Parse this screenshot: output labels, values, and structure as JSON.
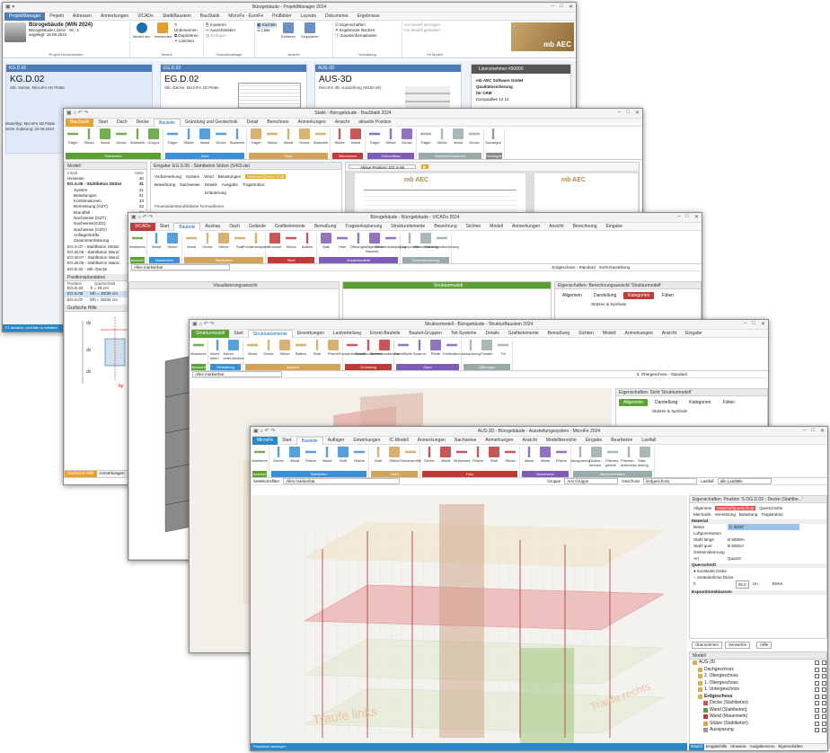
{
  "pm": {
    "title": "Bürogebäude - ProjektManager 2024",
    "tabs": [
      "ProjektManager",
      "Projekt",
      "Adressen",
      "Anmerkungen",
      "ViCADo",
      "StatikBaustein",
      "BauStatik",
      "MicroFe - EuroFe",
      "Prüfbilder",
      "Layouts",
      "Dokumente",
      "Ergebnisse"
    ],
    "project_name": "Bürogebäude (WIN 2024)",
    "project_line2": "Bürogebäude Lizenz - Nr.: 1",
    "project_line3": "angelegt: 18.08.2024",
    "project_group_label": "Projekt Informationen",
    "ribbon": {
      "new_model": "Modell neu",
      "use": "Verwenden",
      "actions": [
        "Unbenennen",
        "Duplizieren",
        "Löschen"
      ],
      "actions2": [
        "Kopieren",
        "Ausschneiden",
        "Einfügen"
      ],
      "view": [
        "Kacheln",
        "Liste"
      ],
      "sort": "Sortieren",
      "group": "Gruppieren",
      "props": [
        "Eigenschaften",
        "Ergebnisse löschen",
        "Zusatzinformationen"
      ],
      "modules": [
        "Ins Modell anzeigen",
        "Ins Modell gestalten"
      ],
      "group_labels": [
        "Projekt Informationen",
        "Modell",
        "Zwischenablage",
        "Ansicht",
        "Verwaltung",
        "Im Modell"
      ]
    },
    "cards": [
      {
        "head": "KG.D.02",
        "title": "KG.D.02",
        "sub": "Stb.-Decke, MicroFe 2D Platte"
      },
      {
        "head": "EG.D.02",
        "title": "EG.D.02",
        "sub": "Stb.-Decke, MicroFe 2D Platte"
      },
      {
        "head": "AUS-3D",
        "title": "AUS-3D",
        "sub": "MicroFe 3D Aussteifung (M150.de)"
      }
    ],
    "license": {
      "head": "Lizenznehmer #50000",
      "l1": "mb AEC Software GmbH",
      "l2": "Qualitätssicherung",
      "l3": "für CRM",
      "l4": "Europaallee 14 14"
    },
    "left_meta": [
      "Modelltyp: MicroFe 2D Platte",
      "letzte Änderung: 20.08.2024"
    ],
    "status": "F1 drücken, um Hilfe zu erhalten"
  },
  "bs": {
    "title": "Statik - Bürogebäude - BauStatik 2024",
    "tabs": [
      "BauStatik",
      "Start",
      "Dach",
      "Decke",
      "Bauteile",
      "Gründung und Geotechnik",
      "Detail",
      "Berechnen",
      "Anmerkungen",
      "Ansicht",
      "aktuelle Position"
    ],
    "ribbon_items": [
      "Träger",
      "Stütze",
      "Wand",
      "Decke",
      "Stabwerk",
      "Gruppe",
      "Träger",
      "Stütze",
      "Wand",
      "Decke",
      "Stabwerk",
      "Träger",
      "Stütze",
      "Wand",
      "Decke",
      "Stabwerk",
      "Stütze",
      "Wand",
      "Träger",
      "Stütze",
      "Decke",
      "Träger",
      "Stütze",
      "Wand",
      "Decke",
      "Sonstiges"
    ],
    "group_labels": [
      "Stahlbeton",
      "Stahl",
      "Holz",
      "Mauerwerk",
      "Verbundbau",
      "Schwelle/Zwischen",
      "Sonstiges"
    ],
    "tree_header": [
      "Inhalt",
      "Seite",
      "S."
    ],
    "tree": [
      {
        "t": "Hinweise",
        "p": "30"
      },
      {
        "t": "EG.S.06 - Stahlbeton Stütze",
        "p": "31"
      },
      {
        "t": "System",
        "p": "31"
      },
      {
        "t": "Belastungen",
        "p": "31"
      },
      {
        "t": "Kombinationen",
        "p": "33"
      },
      {
        "t": "Bemessung (GZT)",
        "p": "33"
      },
      {
        "t": "Brandfall",
        "p": "34"
      },
      {
        "t": "Nachweise (GZT)",
        "p": "34"
      },
      {
        "t": "Nachweise(GZG)",
        "p": ""
      },
      {
        "t": "Nachweise (GZG)",
        "p": ""
      },
      {
        "t": "Auflagerkräfte",
        "p": ""
      },
      {
        "t": "Zusammenfassung",
        "p": ""
      },
      {
        "t": "EG.S.07 - Stahlbeton Stütze",
        "p": ""
      },
      {
        "t": "EG.W.05 - Stahlbeton Wand",
        "p": ""
      },
      {
        "t": "EG.W.07 - Stahlbeton Wand",
        "p": ""
      },
      {
        "t": "EG.W.08 - Stahlbeton Wand",
        "p": ""
      },
      {
        "t": "EG.D.02 - Stb.-Decke",
        "p": ""
      }
    ],
    "pos_header": "Positionsplandaten",
    "pos_cols": [
      "Position",
      "Querschnitt"
    ],
    "pos_rows": [
      [
        "EG.D.02",
        "h = 26 cm"
      ],
      [
        "EG.S.06",
        "b/h = 30/30 cm"
      ],
      [
        "EG.S.07",
        "b/h = 32/32 cm"
      ]
    ],
    "graphic_header": "Grafische Hilfe",
    "input_header": "Eingabe: EG.S.06 - Stahlbeton Stütze (S403.de)",
    "input_tabs": [
      "Vorbemerkung",
      "System",
      "Wind",
      "Belastungen",
      "Material/Querschnitt"
    ],
    "input_tabs2": [
      "Bewehrung",
      "Nachweise",
      "Details",
      "Ausgabe",
      "Tragstruktur"
    ],
    "input_sub": "Erläuterung",
    "input_sub2": "Feuerwiderstandsklasse Normalbeton",
    "bottom_tabs": [
      "Grafische Hilfe",
      "Anmerkungen"
    ],
    "logo": "mb AEC"
  },
  "vc": {
    "title": "Bürogebäude - Bürogebäude - ViCADo 2024",
    "tabs": [
      "ViCADo",
      "Start",
      "Bauteile",
      "Ausbau",
      "Dach",
      "Gelände",
      "Grafikelemente",
      "Bemaßung",
      "Tragwerksplanung",
      "Strukturelemente",
      "Bewehrung",
      "Sichten",
      "Modell",
      "Anmerkungen",
      "Ansicht",
      "Berechnung",
      "Eingabe"
    ],
    "ribbon_items": [
      "Markieren",
      "Wand",
      "Stütze",
      "Wand",
      "Decke",
      "Stütze",
      "Stab",
      "Fundamentplatte",
      "Konsole",
      "Stütze",
      "Balken",
      "Stab",
      "Holz",
      "Öffnungen",
      "Allgemeine Bauteile",
      "Deckenaussparung",
      "Querschnitte",
      "Nieswänderung",
      "Bauteilpositionierung"
    ],
    "group_labels": [
      "Auswahl",
      "Mauerwerk",
      "Stahlbeton",
      "Stahl",
      "Zusatzbauteile",
      "Dimensionierung"
    ],
    "filter": "Alles markierbar",
    "view_left": "Visualisierungsansicht",
    "view_right": "Strukturmodell",
    "props_title": "Eigenschaften: Berechnungsansicht 'Strukturmodell'",
    "props_tabs": [
      "Allgemein",
      "Darstellung",
      "Kategorien",
      "Folien"
    ],
    "props_sub": "Stützen & Symbole",
    "floor": "Erdgeschoss - Standard",
    "view_mode": "Sicht-Darstellung"
  },
  "sm": {
    "title": "Strukturmodell - Bürogebäude - StrukturBaustein 2024",
    "tabs": [
      "Strukturmodell",
      "Start",
      "Strukturelemente",
      "Einwirkungen",
      "Lastverteilung",
      "Einzel-Bauteile",
      "Bauteil-Gruppen",
      "Teil-Systeme",
      "Details",
      "Grafikelemente",
      "Bemaßung",
      "Sichten",
      "Modell",
      "Anmerkungen",
      "Ansicht",
      "Eingabe"
    ],
    "ribbon_items": [
      "Markieren",
      "Wand teilen",
      "Autom. unterdrücken",
      "Wand",
      "Decke",
      "Stütze",
      "Balken",
      "Stab",
      "Fläche",
      "Fundamentplatte",
      "Einzelfundament",
      "Streifenfundament",
      "Dachfläche",
      "Sparren",
      "Pfette",
      "Kehlbalken",
      "Aussparung",
      "Fenster",
      "Tür"
    ],
    "group_labels": [
      "Auswahl",
      "Verwaltung",
      "Bauteile",
      "Gründung",
      "Dach",
      "Öffnungen"
    ],
    "filter": "Alles markierbar",
    "floor": "3. Obergeschoss - Standard",
    "props_title": "Eigenschaften: Sicht 'Strukturmodell'",
    "props_tabs": [
      "Allgemein",
      "Darstellung",
      "Kategorien",
      "Folien"
    ],
    "props_sub": "Stützen & Symbole"
  },
  "aus": {
    "title": "AUS-3D - Bürogebäude - Aussteifungssystem - MicroFe 2024",
    "tabs": [
      "MicroFe",
      "Start",
      "Bauteile",
      "Auflager",
      "Einwirkungen",
      "IC-Modell",
      "Anmerkungen",
      "Nachweise",
      "Anmerkungen",
      "Ansicht",
      "Modellbereiche",
      "Eingabe",
      "Bearbeiten",
      "Lastfall"
    ],
    "ribbon_items": [
      "Markieren",
      "Decke",
      "Wand",
      "Fläche",
      "Wand",
      "Stab",
      "Fläche",
      "Stab",
      "Stütze",
      "Sonderprofile",
      "Decke",
      "Wand",
      "Stützwand",
      "Fläche",
      "Stab",
      "Stütze",
      "Wand",
      "Wand",
      "Fläche",
      "Aussparung",
      "Dicken-bereich",
      "Flächen-gelenk",
      "Flächen-anschluss",
      "Stab-lösung"
    ],
    "group_labels": [
      "Auswahl",
      "Stahlbeton",
      "Stahl",
      "Holz",
      "Mauerwerk",
      "Besonderheiten"
    ],
    "filter_label": "Selektionsfilter",
    "filter": "Alles markierbar",
    "group": "Gruppe",
    "group_val": "Arsi Gruppe",
    "floor_label": "Geschoss",
    "floor": "Erdgeschoss",
    "lastfall": "Lastfall",
    "lastfall_val": "alle Lastfälle",
    "props_title": "Eigenschaften: Position 'S.OG.D.02 - Decke (Stahlbe...'",
    "props_tabs": [
      "Allgemein",
      "Material/Querschnitt",
      "Querschnitte"
    ],
    "props_tabs2": [
      "Mechanik",
      "Vernetzung",
      "Belastung",
      "Tragstruktur"
    ],
    "material_head": "Material",
    "rows": [
      {
        "k": "Beton",
        "v": "C 30/37"
      },
      {
        "k": "Luftporenbeton",
        "v": ""
      },
      {
        "k": "Stahl längs",
        "v": "B 500MA"
      },
      {
        "k": "Stahl quer",
        "v": "B 500SA"
      },
      {
        "k": "Gesteinskörnung",
        "v": ""
      },
      {
        "k": "Art",
        "v": "Quarzit"
      }
    ],
    "qs_head": "Querschnitt",
    "qs_opts": [
      "konstante Dicke",
      "veränderliche Dicke"
    ],
    "h_label": "h",
    "h_val": "26,0",
    "h_unit": "cm",
    "h_right": "Dicke",
    "exp_head": "Expositionsklassen",
    "buttons": [
      "Übernehmen",
      "Verwerfen",
      "Hilfe"
    ],
    "model_head": "Modell",
    "model_tree": [
      {
        "t": "AUS-3D",
        "lvl": 0
      },
      {
        "t": "Dachgeschoss",
        "lvl": 1
      },
      {
        "t": "2. Obergeschoss",
        "lvl": 1
      },
      {
        "t": "1. Obergeschoss",
        "lvl": 1
      },
      {
        "t": "1. Untergeschoss",
        "lvl": 1
      },
      {
        "t": "Erdgeschoss",
        "lvl": 1
      },
      {
        "t": "Decke (Stahlbeton)",
        "lvl": 2
      },
      {
        "t": "Wand (Stahlbeton)",
        "lvl": 2
      },
      {
        "t": "Wand (Mauerwerk)",
        "lvl": 2
      },
      {
        "t": "Stütze (Stahlbeton)",
        "lvl": 2
      },
      {
        "t": "Aussparung",
        "lvl": 2
      }
    ],
    "bottom_tabs": [
      "Modell",
      "Eingabehilfe",
      "Hinweise",
      "Ausgabemenu",
      "Eigenschaften"
    ],
    "status": "Positionen anzeigen",
    "label_left": "Traufe links",
    "label_right": "Traufe rechts"
  },
  "colors": {
    "stahlbeton": "#5aa132",
    "stahl": "#3a8fd6",
    "holz": "#d2a35a",
    "mauerwerk": "#c03a3a",
    "verbund": "#7e5bb5",
    "accent": "#2a88c8",
    "model_red": "#e34a4a",
    "model_green": "#7fb96a"
  }
}
